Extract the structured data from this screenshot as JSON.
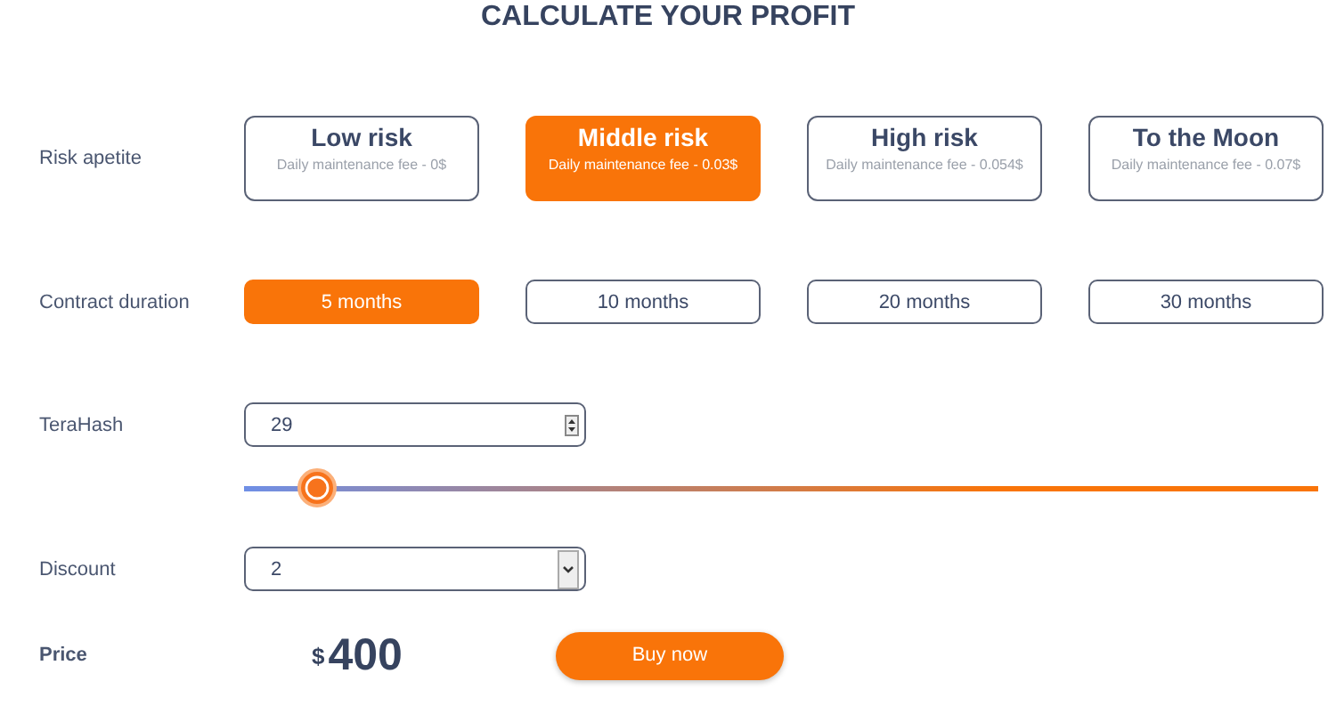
{
  "title": "CALCULATE YOUR PROFIT",
  "risk": {
    "label": "Risk apetite",
    "options": [
      {
        "name": "Low risk",
        "fee": "Daily maintenance fee - 0$",
        "selected": false
      },
      {
        "name": "Middle risk",
        "fee": "Daily maintenance fee - 0.03$",
        "selected": true
      },
      {
        "name": "High risk",
        "fee": "Daily maintenance fee - 0.054$",
        "selected": false
      },
      {
        "name": "To the Moon",
        "fee": "Daily maintenance fee - 0.07$",
        "selected": false
      }
    ]
  },
  "duration": {
    "label": "Contract duration",
    "options": [
      {
        "label": "5 months",
        "selected": true
      },
      {
        "label": "10 months",
        "selected": false
      },
      {
        "label": "20 months",
        "selected": false
      },
      {
        "label": "30 months",
        "selected": false
      }
    ]
  },
  "terahash": {
    "label": "TeraHash",
    "value": "29",
    "level": 0.043
  },
  "discount": {
    "label": "Discount",
    "value": "2"
  },
  "price": {
    "label": "Price",
    "currency": "$",
    "amount": "400"
  },
  "buy_button": "Buy now"
}
